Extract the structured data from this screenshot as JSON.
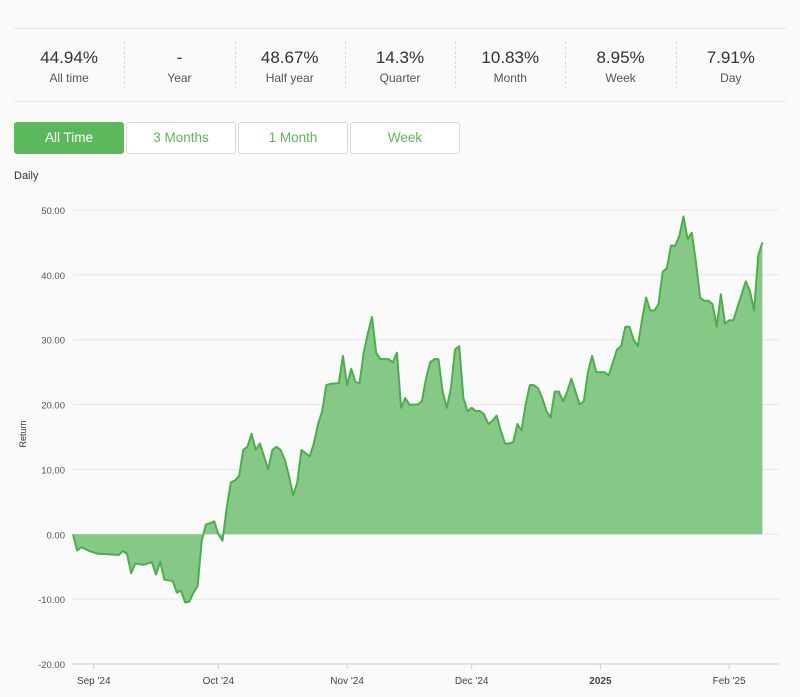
{
  "stats": [
    {
      "value": "44.94%",
      "label": "All time"
    },
    {
      "value": "-",
      "label": "Year"
    },
    {
      "value": "48.67%",
      "label": "Half year"
    },
    {
      "value": "14.3%",
      "label": "Quarter"
    },
    {
      "value": "10.83%",
      "label": "Month"
    },
    {
      "value": "8.95%",
      "label": "Week"
    },
    {
      "value": "7.91%",
      "label": "Day"
    }
  ],
  "tabs": [
    {
      "label": "All Time",
      "active": true
    },
    {
      "label": "3 Months",
      "active": false
    },
    {
      "label": "1 Month",
      "active": false
    },
    {
      "label": "Week",
      "active": false
    }
  ],
  "chart_title": "Daily",
  "chart_data": {
    "type": "area",
    "ylabel": "Return",
    "xlabel": "",
    "ylim": [
      -20,
      50
    ],
    "yticks": [
      -20,
      -10,
      0,
      10,
      20,
      30,
      40,
      50
    ],
    "ytick_labels": [
      "-20.00",
      "-10.00",
      "0.00",
      "10.00",
      "20.00",
      "30.00",
      "40.00",
      "50.00"
    ],
    "xlim": [
      "2024-08-27",
      "2025-02-13"
    ],
    "xticks": [
      {
        "date": "2024-09-01",
        "label": "Sep '24",
        "bold": false
      },
      {
        "date": "2024-10-01",
        "label": "Oct '24",
        "bold": false
      },
      {
        "date": "2024-11-01",
        "label": "Nov '24",
        "bold": false
      },
      {
        "date": "2024-12-01",
        "label": "Dec '24",
        "bold": false
      },
      {
        "date": "2025-01-01",
        "label": "2025",
        "bold": true
      },
      {
        "date": "2025-02-01",
        "label": "Feb '25",
        "bold": false
      }
    ],
    "fill_color": "#86c986",
    "line_color": "#4cae4c",
    "grid": true,
    "series": [
      {
        "points": [
          [
            "2024-08-27",
            0
          ],
          [
            "2024-08-28",
            -2.5
          ],
          [
            "2024-08-29",
            -2
          ],
          [
            "2024-08-31",
            -2.6
          ],
          [
            "2024-09-02",
            -3
          ],
          [
            "2024-09-05",
            -3.1
          ],
          [
            "2024-09-07",
            -3.2
          ],
          [
            "2024-09-08",
            -2.6
          ],
          [
            "2024-09-09",
            -3
          ],
          [
            "2024-09-10",
            -6
          ],
          [
            "2024-09-11",
            -4.5
          ],
          [
            "2024-09-13",
            -4.7
          ],
          [
            "2024-09-15",
            -4.3
          ],
          [
            "2024-09-16",
            -6.2
          ],
          [
            "2024-09-17",
            -4.2
          ],
          [
            "2024-09-18",
            -7
          ],
          [
            "2024-09-20",
            -7.2
          ],
          [
            "2024-09-21",
            -9
          ],
          [
            "2024-09-22",
            -8.7
          ],
          [
            "2024-09-23",
            -10.5
          ],
          [
            "2024-09-24",
            -10.4
          ],
          [
            "2024-09-25",
            -9
          ],
          [
            "2024-09-26",
            -8
          ],
          [
            "2024-09-27",
            -1
          ],
          [
            "2024-09-28",
            1.5
          ],
          [
            "2024-09-29",
            1.7
          ],
          [
            "2024-09-30",
            2
          ],
          [
            "2024-10-01",
            0
          ],
          [
            "2024-10-02",
            -1
          ],
          [
            "2024-10-03",
            4
          ],
          [
            "2024-10-04",
            8
          ],
          [
            "2024-10-05",
            8.3
          ],
          [
            "2024-10-06",
            9
          ],
          [
            "2024-10-07",
            13
          ],
          [
            "2024-10-08",
            13.5
          ],
          [
            "2024-10-09",
            15.5
          ],
          [
            "2024-10-10",
            13
          ],
          [
            "2024-10-11",
            14
          ],
          [
            "2024-10-12",
            12
          ],
          [
            "2024-10-13",
            10
          ],
          [
            "2024-10-14",
            13
          ],
          [
            "2024-10-15",
            13.5
          ],
          [
            "2024-10-16",
            13
          ],
          [
            "2024-10-17",
            11.5
          ],
          [
            "2024-10-18",
            9
          ],
          [
            "2024-10-19",
            6
          ],
          [
            "2024-10-20",
            8
          ],
          [
            "2024-10-21",
            13
          ],
          [
            "2024-10-22",
            12.5
          ],
          [
            "2024-10-23",
            12
          ],
          [
            "2024-10-24",
            14
          ],
          [
            "2024-10-25",
            17
          ],
          [
            "2024-10-26",
            19
          ],
          [
            "2024-10-27",
            23
          ],
          [
            "2024-10-28",
            23.2
          ],
          [
            "2024-10-30",
            23.3
          ],
          [
            "2024-10-31",
            27.5
          ],
          [
            "2024-11-01",
            23
          ],
          [
            "2024-11-02",
            25.5
          ],
          [
            "2024-11-03",
            23.5
          ],
          [
            "2024-11-04",
            23.3
          ],
          [
            "2024-11-05",
            28
          ],
          [
            "2024-11-06",
            31
          ],
          [
            "2024-11-07",
            33.5
          ],
          [
            "2024-11-08",
            28
          ],
          [
            "2024-11-09",
            27
          ],
          [
            "2024-11-11",
            27
          ],
          [
            "2024-11-12",
            26.5
          ],
          [
            "2024-11-13",
            28
          ],
          [
            "2024-11-14",
            19.5
          ],
          [
            "2024-11-15",
            21
          ],
          [
            "2024-11-16",
            20
          ],
          [
            "2024-11-18",
            20
          ],
          [
            "2024-11-19",
            20.5
          ],
          [
            "2024-11-20",
            24
          ],
          [
            "2024-11-21",
            26.5
          ],
          [
            "2024-11-22",
            27
          ],
          [
            "2024-11-23",
            27
          ],
          [
            "2024-11-24",
            22
          ],
          [
            "2024-11-25",
            19.5
          ],
          [
            "2024-11-26",
            22.5
          ],
          [
            "2024-11-27",
            28.5
          ],
          [
            "2024-11-28",
            29
          ],
          [
            "2024-11-29",
            21
          ],
          [
            "2024-11-30",
            19
          ],
          [
            "2024-12-01",
            19.5
          ],
          [
            "2024-12-02",
            19
          ],
          [
            "2024-12-03",
            19
          ],
          [
            "2024-12-04",
            18.5
          ],
          [
            "2024-12-05",
            17
          ],
          [
            "2024-12-06",
            17.5
          ],
          [
            "2024-12-07",
            18.3
          ],
          [
            "2024-12-08",
            16
          ],
          [
            "2024-12-09",
            14
          ],
          [
            "2024-12-10",
            14
          ],
          [
            "2024-12-11",
            14.2
          ],
          [
            "2024-12-12",
            17
          ],
          [
            "2024-12-13",
            16
          ],
          [
            "2024-12-14",
            20
          ],
          [
            "2024-12-15",
            23
          ],
          [
            "2024-12-16",
            23
          ],
          [
            "2024-12-17",
            22.5
          ],
          [
            "2024-12-18",
            21
          ],
          [
            "2024-12-19",
            19
          ],
          [
            "2024-12-20",
            18
          ],
          [
            "2024-12-21",
            22
          ],
          [
            "2024-12-22",
            22
          ],
          [
            "2024-12-23",
            20.5
          ],
          [
            "2024-12-24",
            22
          ],
          [
            "2024-12-25",
            24
          ],
          [
            "2024-12-26",
            22
          ],
          [
            "2024-12-27",
            20
          ],
          [
            "2024-12-28",
            20.5
          ],
          [
            "2024-12-29",
            25
          ],
          [
            "2024-12-30",
            27.5
          ],
          [
            "2024-12-31",
            25
          ],
          [
            "2025-01-01",
            25
          ],
          [
            "2025-01-02",
            25
          ],
          [
            "2025-01-03",
            24.5
          ],
          [
            "2025-01-04",
            26.5
          ],
          [
            "2025-01-05",
            28.5
          ],
          [
            "2025-01-06",
            29
          ],
          [
            "2025-01-07",
            32
          ],
          [
            "2025-01-08",
            32
          ],
          [
            "2025-01-09",
            30
          ],
          [
            "2025-01-10",
            29
          ],
          [
            "2025-01-11",
            33
          ],
          [
            "2025-01-12",
            36.5
          ],
          [
            "2025-01-13",
            34.5
          ],
          [
            "2025-01-14",
            34.5
          ],
          [
            "2025-01-15",
            35.5
          ],
          [
            "2025-01-16",
            40.5
          ],
          [
            "2025-01-17",
            41
          ],
          [
            "2025-01-18",
            44.5
          ],
          [
            "2025-01-19",
            44.5
          ],
          [
            "2025-01-20",
            46
          ],
          [
            "2025-01-21",
            49
          ],
          [
            "2025-01-22",
            45.5
          ],
          [
            "2025-01-23",
            46.5
          ],
          [
            "2025-01-24",
            42
          ],
          [
            "2025-01-25",
            36.5
          ],
          [
            "2025-01-26",
            36
          ],
          [
            "2025-01-27",
            36
          ],
          [
            "2025-01-28",
            35.5
          ],
          [
            "2025-01-29",
            32
          ],
          [
            "2025-01-30",
            37
          ],
          [
            "2025-01-31",
            32.5
          ],
          [
            "2025-02-01",
            33
          ],
          [
            "2025-02-02",
            33
          ],
          [
            "2025-02-03",
            35
          ],
          [
            "2025-02-04",
            37
          ],
          [
            "2025-02-05",
            39
          ],
          [
            "2025-02-06",
            37.5
          ],
          [
            "2025-02-07",
            34.5
          ],
          [
            "2025-02-08",
            43
          ],
          [
            "2025-02-09",
            45
          ]
        ]
      }
    ]
  }
}
